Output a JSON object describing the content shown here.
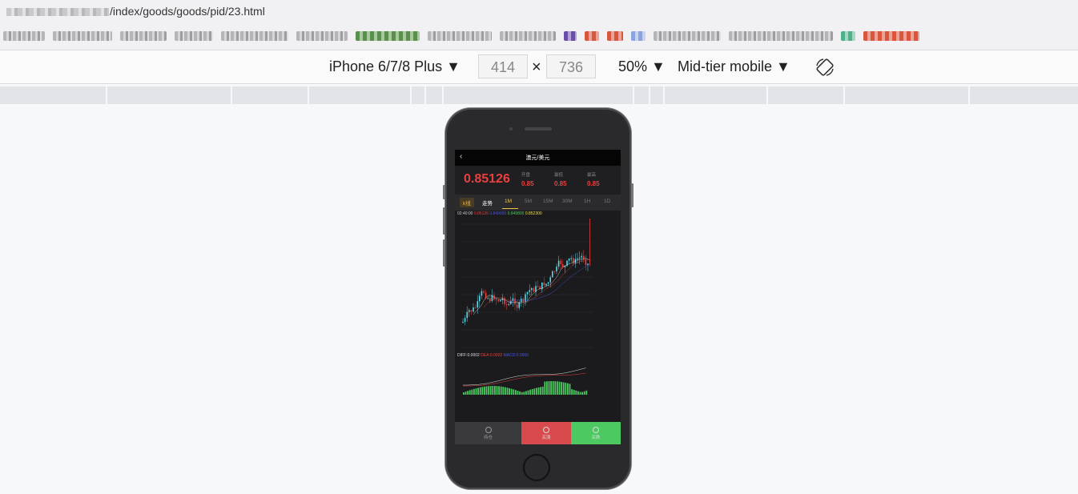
{
  "browser": {
    "url_suffix": "/index/goods/goods/pid/23.html"
  },
  "device_toolbar": {
    "device": "iPhone 6/7/8 Plus ▼",
    "width": "414",
    "times": "×",
    "height": "736",
    "zoom": "50% ▼",
    "throttle": "Mid-tier mobile ▼"
  },
  "app": {
    "back": "‹",
    "title": "澳元/美元",
    "price": "0.85126",
    "stats": [
      {
        "label": "开盘",
        "value": "0.85"
      },
      {
        "label": "最低",
        "value": "0.85"
      },
      {
        "label": "最高",
        "value": "0.85"
      }
    ],
    "tabs": [
      "k线",
      "走势",
      "1M",
      "5M",
      "15M",
      "30M",
      "1H",
      "1D"
    ],
    "active_tab": "1M",
    "legend": {
      "time": "02:40:00",
      "close": "0.85126",
      "ma1": "0.849900",
      "ma2": "0.849800",
      "ma3": "0.852300"
    },
    "macd_legend": {
      "diff": "DIFF:0.0002",
      "dea": "DEA:0.0002",
      "macd": "MACD:0.0000"
    },
    "bottom": [
      {
        "label": "持仓"
      },
      {
        "label": "买涨"
      },
      {
        "label": "买跌"
      }
    ]
  },
  "colors": {
    "up": "#e8403f",
    "down": "#5ad8e6",
    "buy_up": "#d84a4c",
    "buy_down": "#4cc960",
    "accent": "#f0c24a"
  }
}
